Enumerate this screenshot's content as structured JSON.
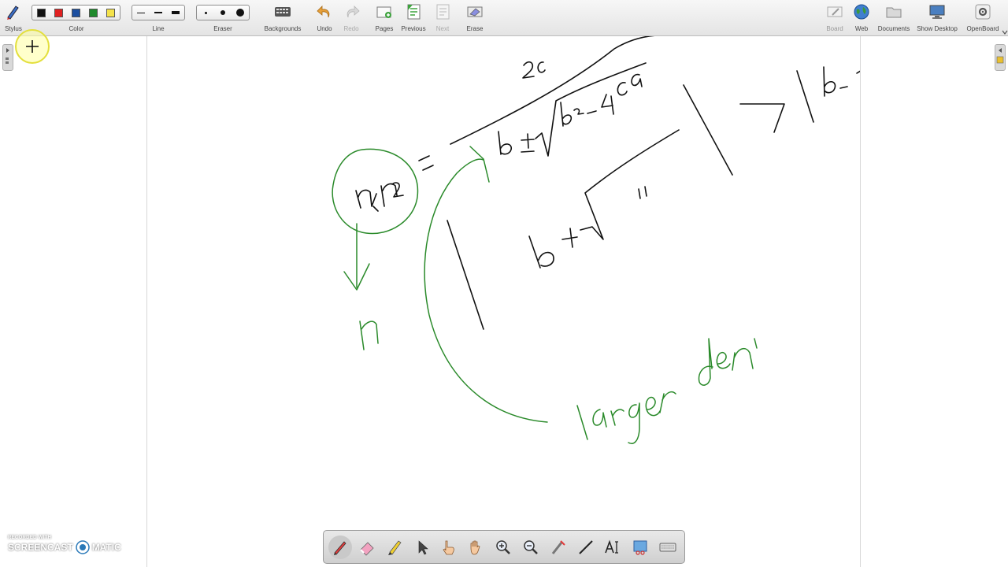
{
  "toolbar": {
    "stylus_label": "Stylus",
    "color_label": "Color",
    "colors": [
      "#111111",
      "#e02020",
      "#1c4fa0",
      "#1f8a2c",
      "#f4e24a"
    ],
    "line_label": "Line",
    "eraser_label": "Eraser",
    "backgrounds_label": "Backgrounds",
    "undo_label": "Undo",
    "redo_label": "Redo",
    "pages_label": "Pages",
    "previous_label": "Previous",
    "next_label": "Next",
    "erase_label": "Erase",
    "board_label": "Board",
    "web_label": "Web",
    "documents_label": "Documents",
    "show_desktop_label": "Show Desktop",
    "openboard_label": "OpenBoard"
  },
  "ink": {
    "black": "#111111",
    "green": "#2a8a2a"
  },
  "watermark": {
    "line1": "RECORDED WITH",
    "line2_a": "SCREENCAST",
    "line2_b": "MATIC"
  }
}
